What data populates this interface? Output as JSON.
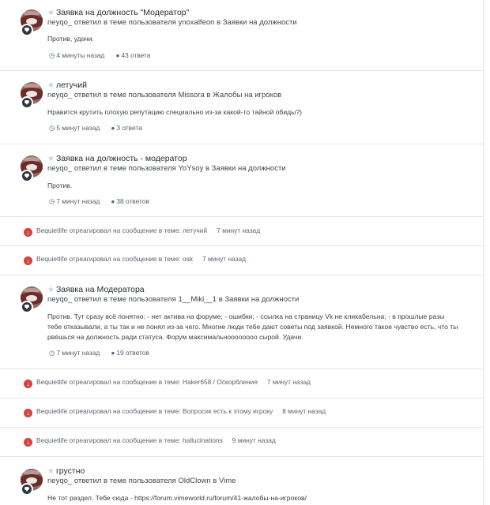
{
  "posts": [
    {
      "title": "Заявка на должность \"Модератор\"",
      "author": "neyqo_",
      "action": "ответил в теме пользователя",
      "topic_owner": "ynoxalfeon",
      "in_word": "в",
      "forum": "Заявки на должности",
      "text": "Против, удачи.",
      "time": "4 минуты назад",
      "replies": "43 ответа"
    },
    {
      "title": "летучий",
      "author": "neyqo_",
      "action": "ответил в теме пользователя",
      "topic_owner": "Missora",
      "in_word": "в",
      "forum": "Жалобы на игроков",
      "text": "Нравится крутить плохую репутацию специально из-за какой-то тайной обиды?)",
      "time": "5 минут назад",
      "replies": "3 ответа"
    },
    {
      "title": "Заявка на должность - модератор",
      "author": "neyqo_",
      "action": "ответил в теме пользователя",
      "topic_owner": "YoYsoy",
      "in_word": "в",
      "forum": "Заявки на должности",
      "text": "Против.",
      "time": "7 минут назад",
      "replies": "38 ответов"
    },
    {
      "title": "Заявка на Модератора",
      "author": "neyqo_",
      "action": "ответил в теме пользователя",
      "topic_owner": "1__Miki__1",
      "in_word": "в",
      "forum": "Заявки на должности",
      "text": "Против. Тут сразу всё понятно: - нет актива на форуме; - ошибки; - ссылка на страницу Vk не кликабельна; - в прошлые разы тебе отказывали, а ты так и не понял из-за чего. Многие люди тебе дают советы под заявкой. Немного такое чувство есть, что ты рвёшься на должность ради статуса. Форум максимальноооооооо сырой. Удачи.",
      "time": "7 минут назад",
      "replies": "19 ответов"
    },
    {
      "title": "грустно",
      "author": "neyqo_",
      "action": "ответил в теме пользователя",
      "topic_owner": "OldClown",
      "in_word": "в",
      "forum": "Vime",
      "text": "Не тот раздел. Тебе сюда - https://forum.vimeworld.ru/forum/41-жалобы-на-игроков/"
    }
  ],
  "reactions": [
    {
      "user": "Bequietlife",
      "text": "отреагировал на сообщение в теме:",
      "topic": "летучий",
      "time": "7 минут назад"
    },
    {
      "user": "Bequietlife",
      "text": "отреагировал на сообщение в теме:",
      "topic": "osk",
      "time": "7 минут назад"
    },
    {
      "user": "Bequietlife",
      "text": "отреагировал на сообщение в теме:",
      "topic": "Haker658 / Оскорбления",
      "time": "7 минут назад"
    },
    {
      "user": "Bequietlife",
      "text": "отреагировал на сообщение в теме:",
      "topic": "Вопросик есть к этому игроку",
      "time": "8 минут назад"
    },
    {
      "user": "Bequietlife",
      "text": "отреагировал на сообщение в теме:",
      "topic": "hallucinations",
      "time": "9 минут назад"
    }
  ],
  "icons": {
    "star": "star-icon",
    "clock": "clock-icon",
    "comments": "comments-icon",
    "reaction": "downvote-reaction-icon",
    "post_badge": "comment-badge-icon"
  },
  "colors": {
    "reaction": "#d3443c",
    "meta_icon": "#4c6a8a",
    "separator": "#e3e5e8"
  }
}
